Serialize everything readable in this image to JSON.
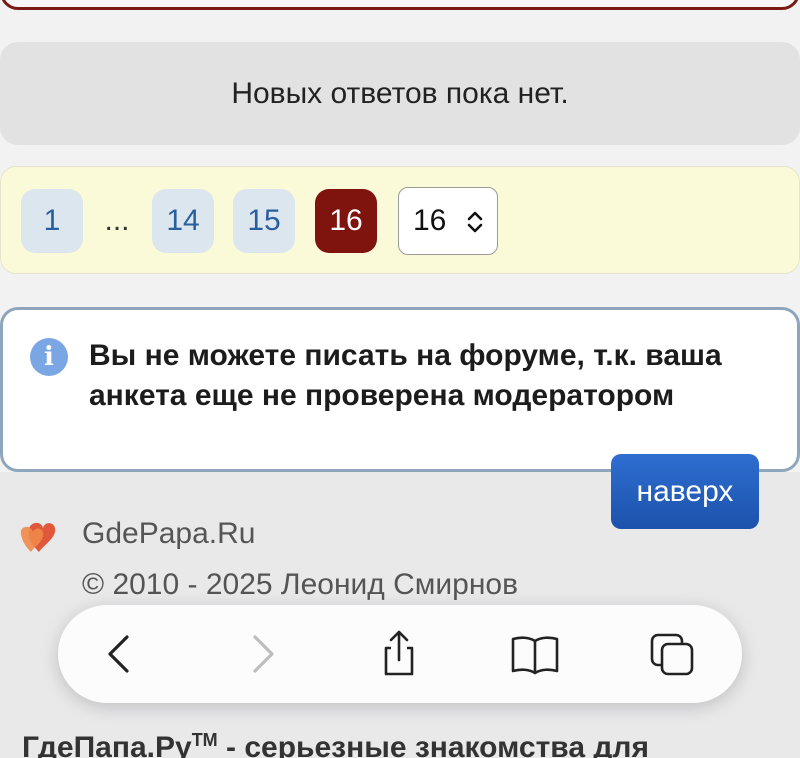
{
  "messages": {
    "no_replies": "Новых ответов пока нет."
  },
  "pagination": {
    "first": "1",
    "ellipsis": "...",
    "page_14": "14",
    "page_15": "15",
    "current": "16",
    "select_value": "16"
  },
  "notice": {
    "icon": "info-icon",
    "text": "Вы не можете писать на форуме, т.к. ваша анкета еще не проверена модератором"
  },
  "back_to_top": "наверх",
  "footer": {
    "brand": "GdePapa.Ru",
    "copyright": "© 2010 - 2025 Леонид Смирнов",
    "tagline_name": "ГдеПапа.Ру",
    "tagline_tm": "TM",
    "tagline_rest": " - серьезные знакомства для"
  },
  "browser_toolbar": {
    "icons": [
      "back-icon",
      "forward-icon",
      "share-icon",
      "bookmarks-icon",
      "tabs-icon"
    ]
  },
  "colors": {
    "accent": "#7f130e",
    "link": "#2a5f9e",
    "button_blue": "#1c52ac",
    "pager_bg": "#fafad8"
  }
}
